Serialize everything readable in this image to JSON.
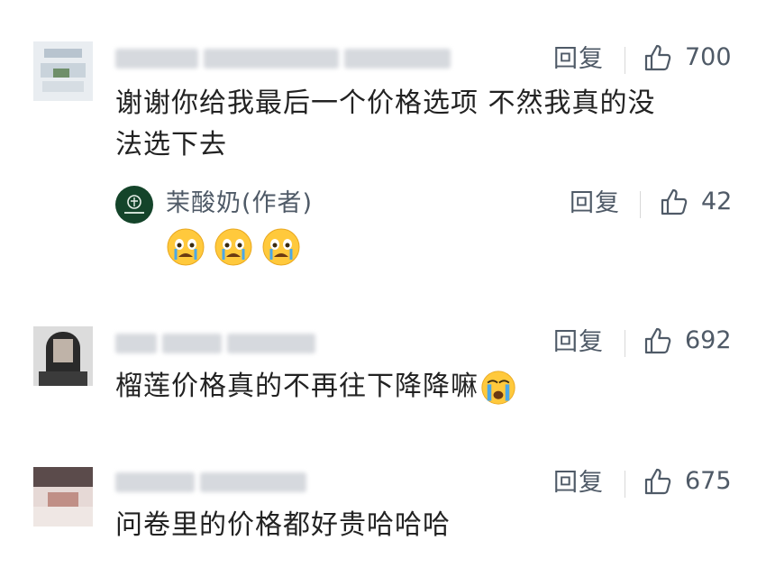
{
  "comments": [
    {
      "reply_label": "回复",
      "likes": "700",
      "text": "谢谢你给我最后一个价格选项 不然我真的没法选下去",
      "text_line1": "谢谢你给我最后一个价格选项 不然我真的没",
      "text_line2": "法选下去",
      "reply": {
        "author": "茉酸奶(作者)",
        "reply_label": "回复",
        "likes": "42",
        "emoji": [
          "crying-face",
          "crying-face",
          "crying-face"
        ]
      }
    },
    {
      "reply_label": "回复",
      "likes": "692",
      "text": "榴莲价格真的不再往下降降嘛",
      "emoji": "crying-face"
    },
    {
      "reply_label": "回复",
      "likes": "675",
      "text": "问卷里的价格都好贵哈哈哈"
    }
  ],
  "colors": {
    "meta_text": "#4f5a67",
    "body_text": "#222222",
    "brand_green": "#14442a",
    "emoji_yellow": "#ffc93c",
    "tear_blue": "#4aa8e8"
  }
}
